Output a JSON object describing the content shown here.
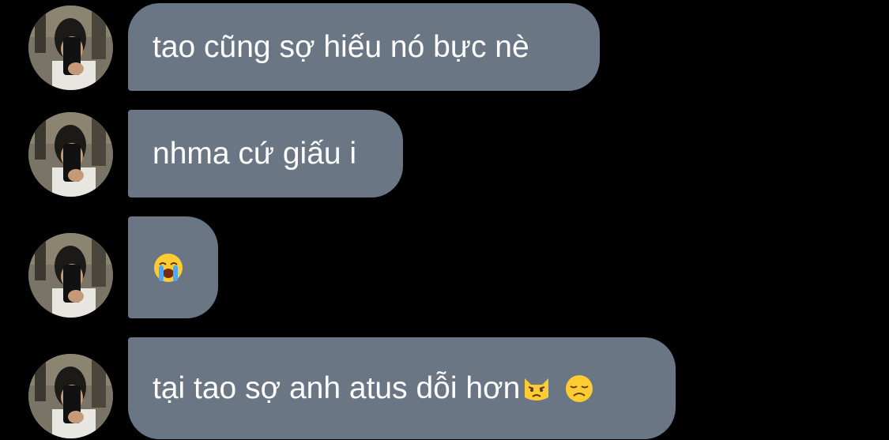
{
  "conversation": {
    "messages": [
      {
        "text": "tao cũng sợ hiếu nó bực nè",
        "emojis": []
      },
      {
        "text": "nhma cứ giấu i",
        "emojis": []
      },
      {
        "text": "",
        "emojis": [
          "loudly-crying-face"
        ]
      },
      {
        "text": "tại tao sợ anh atus dỗi hơn",
        "emojis": [
          "pouting-cat-face",
          "disappointed-face"
        ]
      }
    ]
  },
  "colors": {
    "background": "#000000",
    "bubble": "#6b7685",
    "text": "#ffffff"
  }
}
